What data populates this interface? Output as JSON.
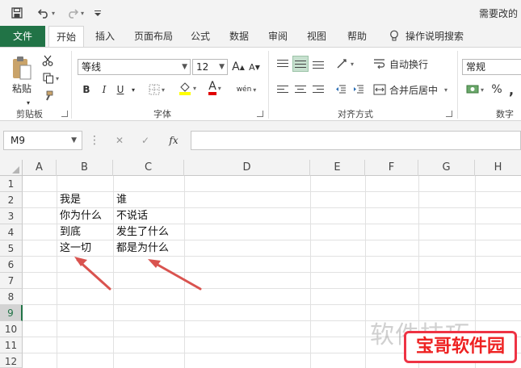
{
  "window": {
    "title": "需要改的"
  },
  "tabs": [
    "文件",
    "开始",
    "插入",
    "页面布局",
    "公式",
    "数据",
    "审阅",
    "视图",
    "帮助",
    "操作说明搜索"
  ],
  "ribbon": {
    "clipboard": {
      "paste_label": "粘贴",
      "group_label": "剪贴板"
    },
    "font": {
      "name": "等线",
      "size": "12",
      "bold": "B",
      "italic": "I",
      "underline": "U",
      "font_color_glyph": "A",
      "phonetic": "wén",
      "group_label": "字体"
    },
    "alignment": {
      "wrap_text": "自动换行",
      "merge_center": "合并后居中",
      "group_label": "对齐方式"
    },
    "number": {
      "format": "常规",
      "percent": "%",
      "comma": ",",
      "group_label": "数字"
    }
  },
  "formula_bar": {
    "name_box": "M9",
    "fx": "fx",
    "cancel": "✕",
    "enter": "✓",
    "value": ""
  },
  "grid": {
    "columns": [
      "A",
      "B",
      "C",
      "D",
      "E",
      "F",
      "G",
      "H"
    ],
    "rows": [
      "1",
      "2",
      "3",
      "4",
      "5",
      "6",
      "7",
      "8",
      "9",
      "10",
      "11",
      "12"
    ],
    "selected_row": "9",
    "cells": {
      "B2": "我是",
      "C2": "谁",
      "B3": "你为什么",
      "C3": "不说话",
      "B4": "到底",
      "C4": "发生了什么",
      "B5": "这一切",
      "C5": "都是为什么"
    }
  },
  "watermark": {
    "line1": "软件技巧",
    "badge": "宝哥软件园"
  },
  "colors": {
    "accent": "#217346",
    "arrow": "#d9534f",
    "badge": "#e33"
  }
}
